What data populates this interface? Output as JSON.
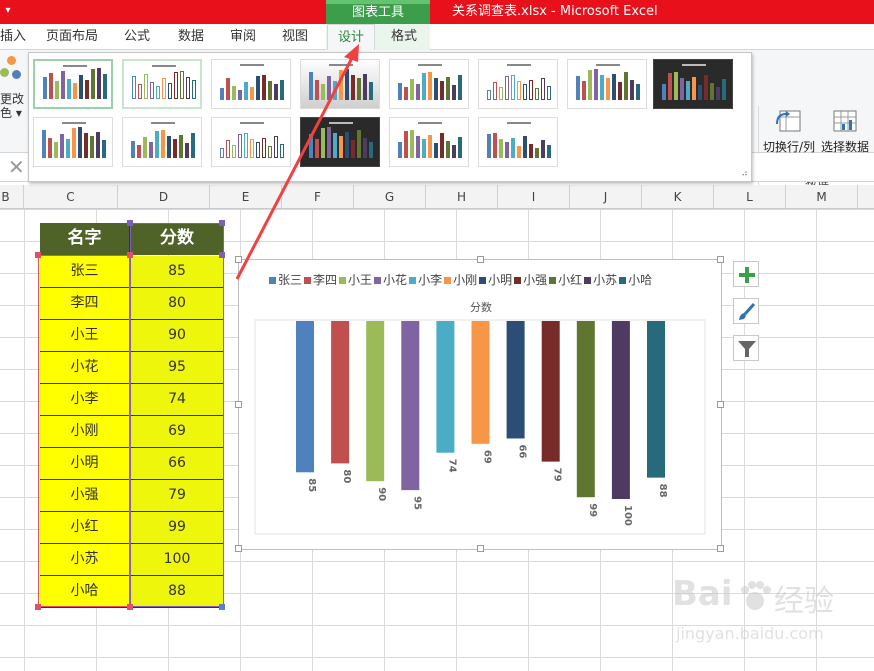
{
  "window": {
    "title": "关系调查表.xlsx -  Microsoft Excel",
    "context_group": "图表工具"
  },
  "ribbon": {
    "tabs": [
      {
        "label": "插入"
      },
      {
        "label": "页面布局"
      },
      {
        "label": "公式"
      },
      {
        "label": "数据"
      },
      {
        "label": "审阅"
      },
      {
        "label": "视图"
      },
      {
        "label": "设计"
      },
      {
        "label": "格式"
      }
    ],
    "active_tab": "设计",
    "left_button_label_line1": "更改",
    "left_button_label_line2": "色 ▾",
    "switch_row_col_label": "切换行/列",
    "select_data_label": "选择数据",
    "data_group_label": "数据"
  },
  "formula_bar": {
    "cancel_glyph": "✕"
  },
  "columns": [
    "B",
    "C",
    "D",
    "E",
    "F",
    "G",
    "H",
    "I",
    "J",
    "K",
    "L",
    "M"
  ],
  "table": {
    "headers": [
      "名字",
      "分数"
    ],
    "rows": [
      {
        "name": "张三",
        "score": "85"
      },
      {
        "name": "李四",
        "score": "80"
      },
      {
        "name": "小王",
        "score": "90"
      },
      {
        "name": "小花",
        "score": "95"
      },
      {
        "name": "小李",
        "score": "74"
      },
      {
        "name": "小刚",
        "score": "69"
      },
      {
        "name": "小明",
        "score": "66"
      },
      {
        "name": "小强",
        "score": "79"
      },
      {
        "name": "小红",
        "score": "99"
      },
      {
        "name": "小苏",
        "score": "100"
      },
      {
        "name": "小哈",
        "score": "88"
      }
    ]
  },
  "chart_data": {
    "type": "bar",
    "title": "分数",
    "orientation": "inverted-vertical",
    "categories": [
      "张三",
      "李四",
      "小王",
      "小花",
      "小李",
      "小刚",
      "小明",
      "小强",
      "小红",
      "小苏",
      "小哈"
    ],
    "values": [
      85,
      80,
      90,
      95,
      74,
      69,
      66,
      79,
      99,
      100,
      88
    ],
    "ylim": [
      0,
      100
    ],
    "legend_position": "top",
    "grid": false,
    "colors": [
      "#4f81bd",
      "#c0504d",
      "#9bbb59",
      "#8064a2",
      "#4bacc6",
      "#f79646",
      "#2c4d75",
      "#772c2a",
      "#5f7530",
      "#4d3b62",
      "#276a7c"
    ]
  },
  "chart_side_buttons": [
    {
      "icon": "plus-icon"
    },
    {
      "icon": "brush-icon"
    },
    {
      "icon": "filter-icon"
    }
  ],
  "watermark": {
    "brand": "Bai",
    "brand2": "经验",
    "url": "jingyan.baidu.com"
  },
  "theme": {
    "title_red": "#e8101a",
    "context_green": "#3c9e4a",
    "header_olive": "#4f6228",
    "cell_yellow": "#ffff00",
    "annotation_arrow": "#f04040"
  }
}
